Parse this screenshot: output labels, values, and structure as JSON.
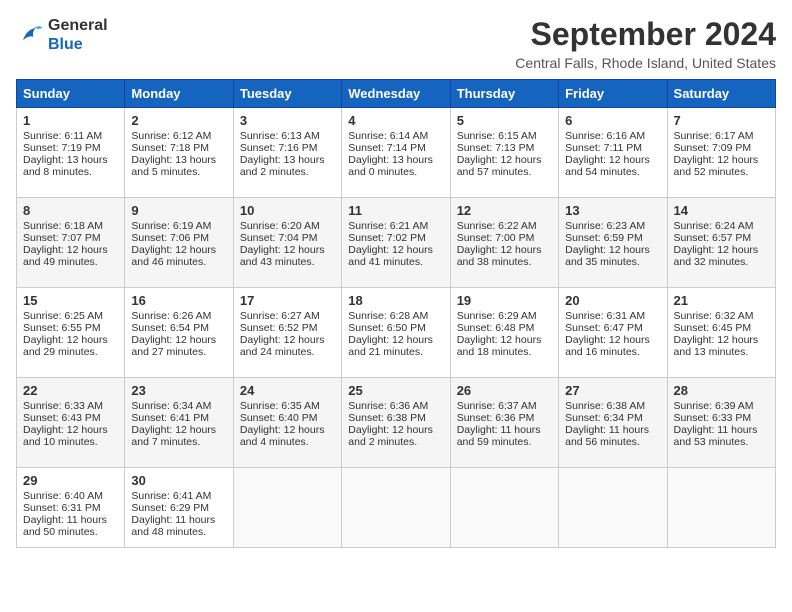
{
  "logo": {
    "line1": "General",
    "line2": "Blue"
  },
  "title": "September 2024",
  "location": "Central Falls, Rhode Island, United States",
  "weekdays": [
    "Sunday",
    "Monday",
    "Tuesday",
    "Wednesday",
    "Thursday",
    "Friday",
    "Saturday"
  ],
  "weeks": [
    [
      {
        "day": "1",
        "sunrise": "6:11 AM",
        "sunset": "7:19 PM",
        "daylight": "13 hours and 8 minutes."
      },
      {
        "day": "2",
        "sunrise": "6:12 AM",
        "sunset": "7:18 PM",
        "daylight": "13 hours and 5 minutes."
      },
      {
        "day": "3",
        "sunrise": "6:13 AM",
        "sunset": "7:16 PM",
        "daylight": "13 hours and 2 minutes."
      },
      {
        "day": "4",
        "sunrise": "6:14 AM",
        "sunset": "7:14 PM",
        "daylight": "13 hours and 0 minutes."
      },
      {
        "day": "5",
        "sunrise": "6:15 AM",
        "sunset": "7:13 PM",
        "daylight": "12 hours and 57 minutes."
      },
      {
        "day": "6",
        "sunrise": "6:16 AM",
        "sunset": "7:11 PM",
        "daylight": "12 hours and 54 minutes."
      },
      {
        "day": "7",
        "sunrise": "6:17 AM",
        "sunset": "7:09 PM",
        "daylight": "12 hours and 52 minutes."
      }
    ],
    [
      {
        "day": "8",
        "sunrise": "6:18 AM",
        "sunset": "7:07 PM",
        "daylight": "12 hours and 49 minutes."
      },
      {
        "day": "9",
        "sunrise": "6:19 AM",
        "sunset": "7:06 PM",
        "daylight": "12 hours and 46 minutes."
      },
      {
        "day": "10",
        "sunrise": "6:20 AM",
        "sunset": "7:04 PM",
        "daylight": "12 hours and 43 minutes."
      },
      {
        "day": "11",
        "sunrise": "6:21 AM",
        "sunset": "7:02 PM",
        "daylight": "12 hours and 41 minutes."
      },
      {
        "day": "12",
        "sunrise": "6:22 AM",
        "sunset": "7:00 PM",
        "daylight": "12 hours and 38 minutes."
      },
      {
        "day": "13",
        "sunrise": "6:23 AM",
        "sunset": "6:59 PM",
        "daylight": "12 hours and 35 minutes."
      },
      {
        "day": "14",
        "sunrise": "6:24 AM",
        "sunset": "6:57 PM",
        "daylight": "12 hours and 32 minutes."
      }
    ],
    [
      {
        "day": "15",
        "sunrise": "6:25 AM",
        "sunset": "6:55 PM",
        "daylight": "12 hours and 29 minutes."
      },
      {
        "day": "16",
        "sunrise": "6:26 AM",
        "sunset": "6:54 PM",
        "daylight": "12 hours and 27 minutes."
      },
      {
        "day": "17",
        "sunrise": "6:27 AM",
        "sunset": "6:52 PM",
        "daylight": "12 hours and 24 minutes."
      },
      {
        "day": "18",
        "sunrise": "6:28 AM",
        "sunset": "6:50 PM",
        "daylight": "12 hours and 21 minutes."
      },
      {
        "day": "19",
        "sunrise": "6:29 AM",
        "sunset": "6:48 PM",
        "daylight": "12 hours and 18 minutes."
      },
      {
        "day": "20",
        "sunrise": "6:31 AM",
        "sunset": "6:47 PM",
        "daylight": "12 hours and 16 minutes."
      },
      {
        "day": "21",
        "sunrise": "6:32 AM",
        "sunset": "6:45 PM",
        "daylight": "12 hours and 13 minutes."
      }
    ],
    [
      {
        "day": "22",
        "sunrise": "6:33 AM",
        "sunset": "6:43 PM",
        "daylight": "12 hours and 10 minutes."
      },
      {
        "day": "23",
        "sunrise": "6:34 AM",
        "sunset": "6:41 PM",
        "daylight": "12 hours and 7 minutes."
      },
      {
        "day": "24",
        "sunrise": "6:35 AM",
        "sunset": "6:40 PM",
        "daylight": "12 hours and 4 minutes."
      },
      {
        "day": "25",
        "sunrise": "6:36 AM",
        "sunset": "6:38 PM",
        "daylight": "12 hours and 2 minutes."
      },
      {
        "day": "26",
        "sunrise": "6:37 AM",
        "sunset": "6:36 PM",
        "daylight": "11 hours and 59 minutes."
      },
      {
        "day": "27",
        "sunrise": "6:38 AM",
        "sunset": "6:34 PM",
        "daylight": "11 hours and 56 minutes."
      },
      {
        "day": "28",
        "sunrise": "6:39 AM",
        "sunset": "6:33 PM",
        "daylight": "11 hours and 53 minutes."
      }
    ],
    [
      {
        "day": "29",
        "sunrise": "6:40 AM",
        "sunset": "6:31 PM",
        "daylight": "11 hours and 50 minutes."
      },
      {
        "day": "30",
        "sunrise": "6:41 AM",
        "sunset": "6:29 PM",
        "daylight": "11 hours and 48 minutes."
      },
      null,
      null,
      null,
      null,
      null
    ]
  ]
}
